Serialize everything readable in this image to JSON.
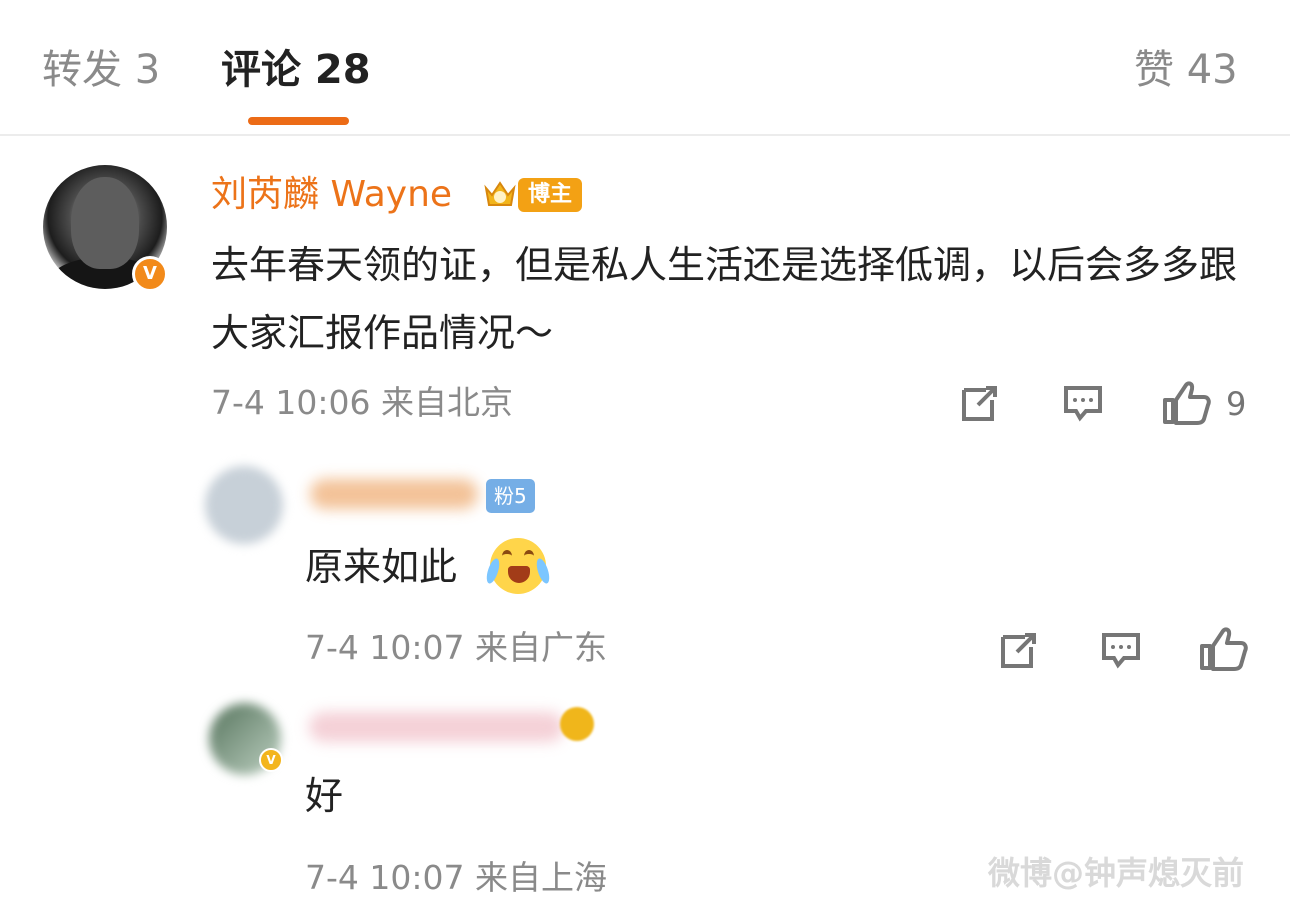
{
  "tabs": {
    "repost": "转发 3",
    "comments": "评论 28",
    "likes": "赞 43"
  },
  "main_comment": {
    "username": "刘芮麟 Wayne",
    "badge": "博主",
    "text": "去年春天领的证，但是私人生活还是选择低调，以后会多多跟大家汇报作品情况～",
    "time_location": "7-4 10:06 来自北京",
    "like_count": "9"
  },
  "replies": [
    {
      "fan_badge": "粉5",
      "text": "原来如此",
      "emoji": "laughing-tears",
      "time_location": "7-4 10:07 来自广东"
    },
    {
      "text": "好",
      "time_location": "7-4 10:07 来自上海"
    }
  ],
  "watermark": "微博@钟声熄灭前",
  "colors": {
    "accent": "#ec6b16",
    "username": "#ec7319",
    "badge": "#f3a114",
    "fan_badge": "#75aee6",
    "meta": "#8a8a8a"
  },
  "icons": [
    "share-icon",
    "comment-icon",
    "like-icon",
    "verified-icon",
    "crown-badge-icon"
  ]
}
